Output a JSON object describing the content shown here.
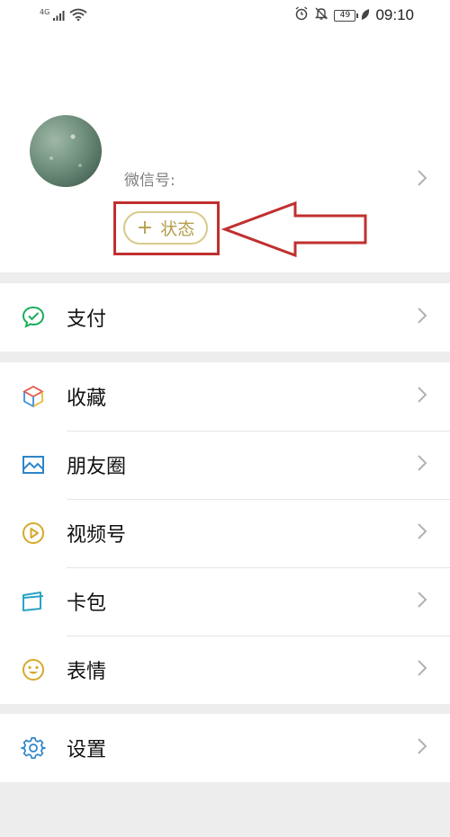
{
  "status_bar": {
    "network": "4G",
    "battery_level": "49",
    "time": "09:10",
    "icons": [
      "signal-icon",
      "wifi-icon",
      "alarm-icon",
      "mute-icon",
      "battery-icon",
      "leaf-icon"
    ]
  },
  "profile": {
    "wechat_id_label": "微信号:",
    "status_button": {
      "plus": "+",
      "label": "状态"
    },
    "annotation": {
      "highlight_color": "#c0302f",
      "arrow": "left-arrow-annotation"
    }
  },
  "menu": {
    "pay": {
      "label": "支付",
      "icon": "pay-icon"
    },
    "favorites": {
      "label": "收藏",
      "icon": "favorites-cube-icon"
    },
    "moments": {
      "label": "朋友圈",
      "icon": "moments-picture-icon"
    },
    "channels": {
      "label": "视频号",
      "icon": "channels-play-icon"
    },
    "cards": {
      "label": "卡包",
      "icon": "card-wallet-icon"
    },
    "stickers": {
      "label": "表情",
      "icon": "smiley-icon"
    },
    "settings": {
      "label": "设置",
      "icon": "gear-icon"
    }
  },
  "colors": {
    "accent_green": "#07c160",
    "status_gold": "#b59f4a",
    "annotation_red": "#c0302f",
    "background": "#ededed"
  }
}
